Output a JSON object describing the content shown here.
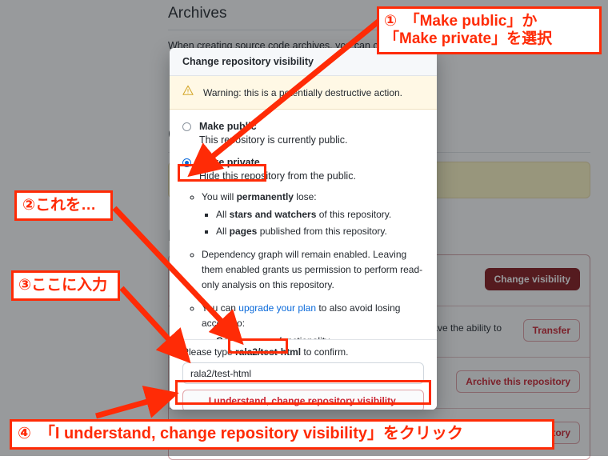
{
  "background": {
    "archives_heading": "Archives",
    "archives_paragraph": "When creating source code archives, you can choose to...",
    "change_visibility_heading": "C",
    "danger_zone_heading": "D",
    "rows": [
      {
        "text": "",
        "button": "Change visibility",
        "style": "solid"
      },
      {
        "text": "you have the ability to",
        "button": "Transfer",
        "style": "outline"
      },
      {
        "text": "",
        "button": "Archive this repository",
        "style": "outline"
      },
      {
        "text": "Delete this repository",
        "button": "Delete this repository",
        "style": "outline"
      }
    ]
  },
  "dialog": {
    "title": "Change repository visibility",
    "warning_icon": "warning-triangle-icon",
    "warning": "Warning: this is a potentially destructive action.",
    "options": [
      {
        "label": "Make public",
        "description": "This repository is currently public.",
        "selected": false
      },
      {
        "label": "Make private",
        "description": "Hide this repository from the public.",
        "selected": true
      }
    ],
    "bullets": [
      {
        "text_before": "You will ",
        "bold": "permanently",
        "text_after": " lose:",
        "children": [
          {
            "text_before": "All ",
            "bold": "stars and watchers",
            "text_after": " of this repository."
          },
          {
            "text_before": "All ",
            "bold": "pages",
            "text_after": " published from this repository."
          }
        ]
      },
      {
        "text_before": "Dependency graph will remain enabled. Leaving them enabled grants us permission to perform read-only analysis on this repository.",
        "bold": "",
        "text_after": "",
        "children": []
      },
      {
        "text_before": "You can ",
        "link": "upgrade your plan",
        "text_after": " to also avoid losing access to:",
        "children": [
          {
            "text_before": "",
            "bold": "Code owners",
            "text_after": " functionality."
          }
        ]
      }
    ],
    "confirm_prefix": "Please type ",
    "confirm_repo": "rala2/test-html",
    "confirm_suffix": " to confirm.",
    "input_value": "rala2/test-html",
    "input_placeholder": "rala2/test-html",
    "confirm_button": "I understand, change repository visibility."
  },
  "annotations": {
    "accent_color": "#ff2b06",
    "callout1_line1": "①　「Make public」か",
    "callout1_line2": "「Make private」を選択",
    "callout2": "②これを…",
    "callout3": "③ここに入力",
    "callout4": "④　「I understand, change repository visibility」をクリック"
  }
}
